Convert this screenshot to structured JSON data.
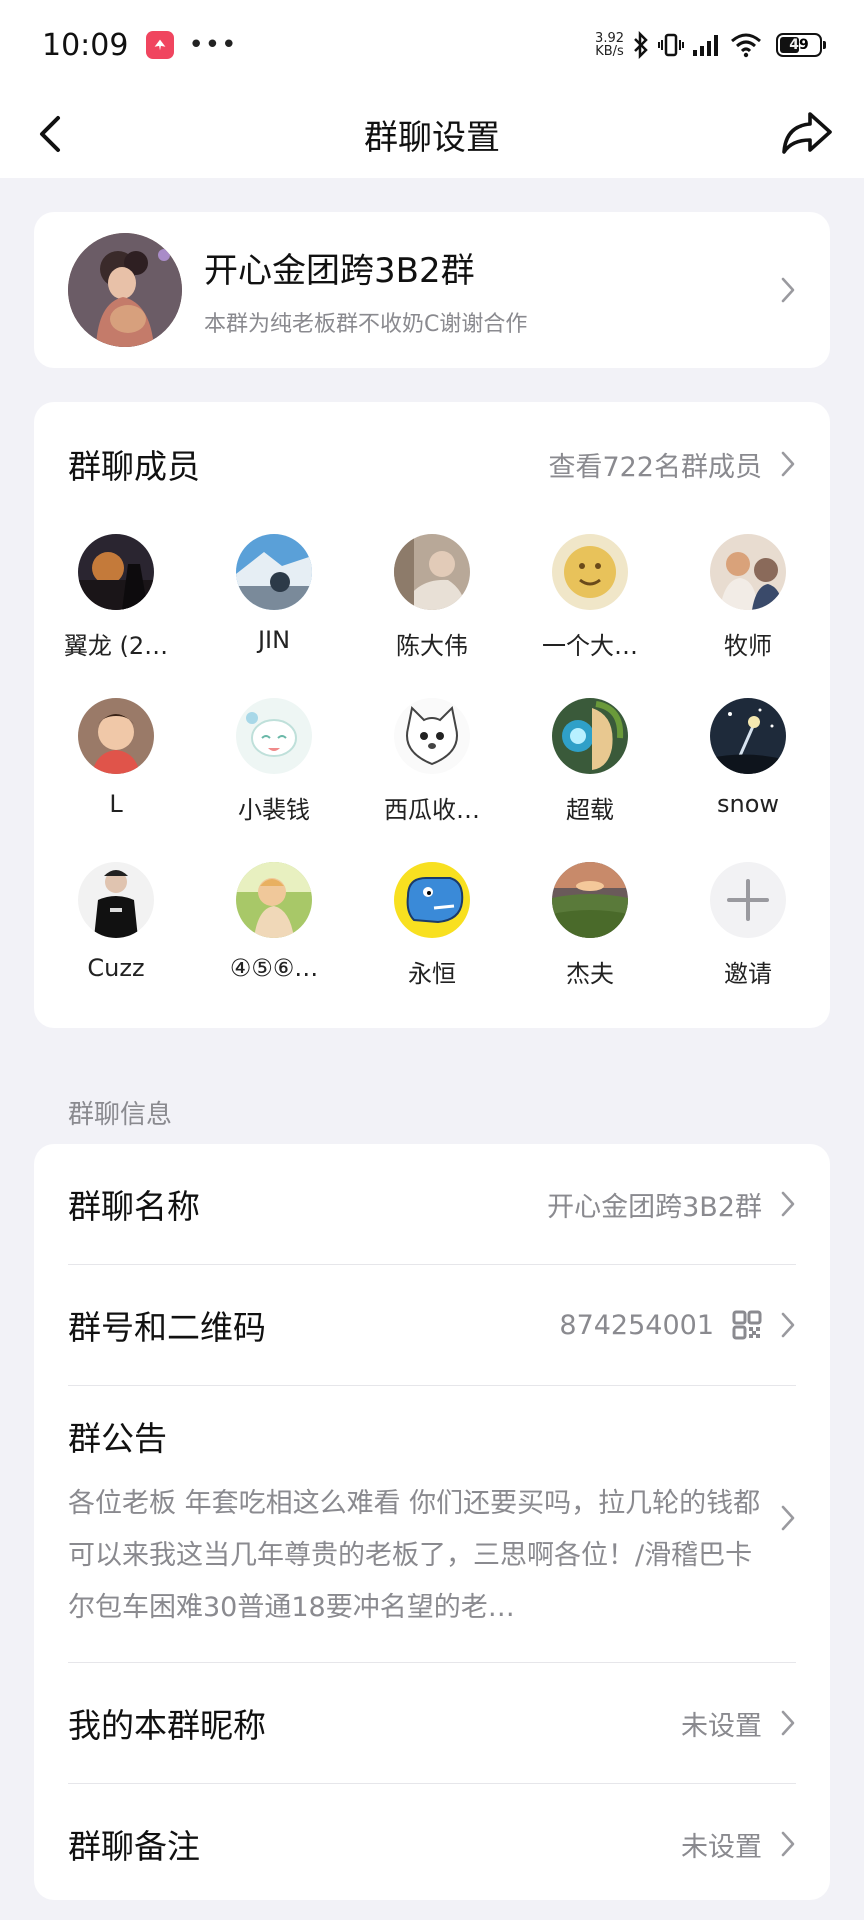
{
  "status_bar": {
    "time": "10:09",
    "net_speed_value": "3.92",
    "net_speed_unit": "KB/s",
    "battery": "49",
    "battery_level": 0.49
  },
  "nav": {
    "title": "群聊设置"
  },
  "group": {
    "name": "开心金团跨3B2群",
    "description": "本群为纯老板群不收奶C谢谢合作"
  },
  "members": {
    "title": "群聊成员",
    "view_all": "查看722名群成员",
    "list": [
      {
        "name": "翼龙 (2…"
      },
      {
        "name": "JIN"
      },
      {
        "name": "陈大伟"
      },
      {
        "name": "一个大…"
      },
      {
        "name": "牧师"
      },
      {
        "name": "L"
      },
      {
        "name": "小裴钱"
      },
      {
        "name": "西瓜收…"
      },
      {
        "name": "超载"
      },
      {
        "name": "snow"
      },
      {
        "name": "Cuzz"
      },
      {
        "name": "④⑤⑥…"
      },
      {
        "name": "永恒"
      },
      {
        "name": "杰夫"
      }
    ],
    "invite_label": "邀请"
  },
  "info_section": {
    "label": "群聊信息",
    "group_name_label": "群聊名称",
    "group_name_value": "开心金团跨3B2群",
    "group_id_label": "群号和二维码",
    "group_id_value": "874254001",
    "notice_label": "群公告",
    "notice_text": "各位老板 年套吃相这么难看 你们还要买吗，拉几轮的钱都可以来我这当几年尊贵的老板了，三思啊各位！/滑稽巴卡尔包车困难30普通18要冲名望的老…",
    "nickname_label": "我的本群昵称",
    "nickname_value": "未设置",
    "remark_label": "群聊备注",
    "remark_value": "未设置"
  },
  "colors": {
    "background": "#f2f2f7",
    "card": "#ffffff",
    "secondary_text": "#8a8a8f",
    "app_badge": "#f0455f"
  }
}
